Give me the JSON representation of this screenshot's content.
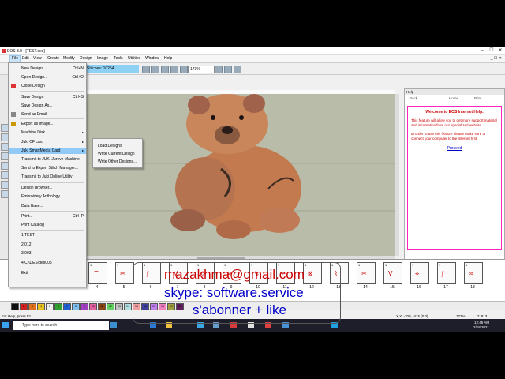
{
  "window": {
    "title": "EOS 3.0 - [TEST.exe]"
  },
  "menubar": [
    "File",
    "Edit",
    "View",
    "Create",
    "Modify",
    "Design",
    "Image",
    "Tools",
    "Utilities",
    "Window",
    "Help"
  ],
  "toolbar": {
    "stitches": "Stitches: 10254",
    "zoom": "173%"
  },
  "file_menu": [
    {
      "label": "New Design",
      "shortcut": "Ctrl+N"
    },
    {
      "label": "Open Design...",
      "shortcut": "Ctrl+O"
    },
    {
      "label": "Close Design",
      "shortcut": ""
    },
    {
      "label": "Save Design",
      "shortcut": "Ctrl+S"
    },
    {
      "label": "Save Design As...",
      "shortcut": ""
    },
    {
      "label": "Send as Email",
      "shortcut": ""
    },
    {
      "label": "Export as Image...",
      "shortcut": ""
    },
    {
      "label": "Machine Disk",
      "shortcut": ""
    },
    {
      "label": "Juki CF card",
      "shortcut": ""
    },
    {
      "label": "Juki SmartMedia Card",
      "shortcut": ""
    },
    {
      "label": "Transmit to JUKI Jureve Machine",
      "shortcut": ""
    },
    {
      "label": "Send to Expert Stitch Manager...",
      "shortcut": ""
    },
    {
      "label": "Transmit to Juki Online Utility",
      "shortcut": ""
    },
    {
      "label": "Design Browser...",
      "shortcut": ""
    },
    {
      "label": "Embroidery Anthology...",
      "shortcut": ""
    },
    {
      "label": "Data Base...",
      "shortcut": ""
    },
    {
      "label": "Print...",
      "shortcut": "Ctrl+P"
    },
    {
      "label": "Print Catalog",
      "shortcut": ""
    },
    {
      "label": "1 TEST",
      "shortcut": ""
    },
    {
      "label": "2 012",
      "shortcut": ""
    },
    {
      "label": "3 003",
      "shortcut": ""
    },
    {
      "label": "4 C:\\DES\\des005",
      "shortcut": ""
    },
    {
      "label": "Exit",
      "shortcut": ""
    }
  ],
  "submenu": [
    "Load Designs",
    "Write Current Design",
    "Write Other Designs..."
  ],
  "help": {
    "header": "Help",
    "back": "Back",
    "home": "Home",
    "print": "Print",
    "title": "Welcome to EOS Internet Help.",
    "p1": "This feature will allow you to get more support material and information from our specialized website.",
    "p2": "In order to use this feature please make sure to connect your computer to the Internet first.",
    "link": "Proceed"
  },
  "steps": [
    "4",
    "5",
    "6",
    "7",
    "8",
    "9",
    "10",
    "11",
    "12",
    "13",
    "14",
    "15",
    "16",
    "17",
    "18"
  ],
  "colors": [
    "#111111",
    "#d02020",
    "#e07020",
    "#e8c020",
    "#f0f0f0",
    "#30a030",
    "#2060d0",
    "#80c0f0",
    "#a040c0",
    "#e060a0",
    "#8b4513",
    "#60d060",
    "#c0c0c0",
    "#b0e0e0",
    "#f0a0a0",
    "#4040a0",
    "#c080f0",
    "#f080c0",
    "#a0a040",
    "#602060"
  ],
  "swatch_numbers": [
    "1",
    "2",
    "3",
    "4",
    "5",
    "6",
    "7",
    "8",
    "9",
    "10",
    "11",
    "12",
    "13",
    "14",
    "15",
    "16",
    "17",
    "18",
    "19",
    "20"
  ],
  "status": {
    "left": "For Help, press F1",
    "coords": "X,Y: -700, -415 (0.0)",
    "zoom": "173%",
    "d": "D: 813"
  },
  "taskbar": {
    "search": "Type here to search",
    "time": "12:45 AM",
    "date": "2/18/2021"
  },
  "overlay": {
    "email": "mazakhma@gmail.com",
    "skype": "skype: software.service",
    "promo": "s'abonner + like"
  }
}
